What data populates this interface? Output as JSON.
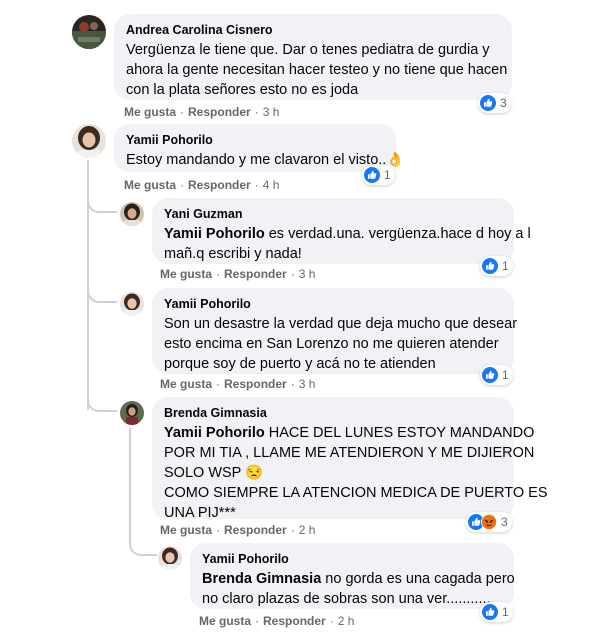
{
  "colors": {
    "bubble": "#f0f2f5",
    "secondary_text": "#65676b",
    "like_blue": "#1877f2",
    "thread_line": "#ced0d4"
  },
  "actions": {
    "like": "Me gusta",
    "reply": "Responder",
    "separator": "·"
  },
  "comments": [
    {
      "author": "Andrea Carolina Cisnero",
      "lines": [
        "Vergüenza le tiene que. Dar o tenes pediatra de gurdia y",
        "ahora la gente necesitan hacer testeo y no tiene que hacen",
        "con la plata señores esto no es joda"
      ],
      "time": "3 h",
      "reactions": {
        "icons": [
          "like-icon"
        ],
        "count": "3"
      }
    },
    {
      "author": "Yamii Pohorilo",
      "lines": [
        "Estoy mandando y me clavaron el visto.."
      ],
      "emoji": "👌",
      "time": "4 h",
      "reactions": {
        "icons": [
          "like-icon"
        ],
        "count": "1"
      }
    },
    {
      "author": "Yani Guzman",
      "mention": "Yamii Pohorilo",
      "lines": [
        " es verdad.una. vergüenza.hace d hoy a l",
        "mañ.q escribi y nada!"
      ],
      "time": "3 h",
      "reactions": {
        "icons": [
          "like-icon"
        ],
        "count": "1"
      }
    },
    {
      "author": "Yamii Pohorilo",
      "lines": [
        "Son un desastre la verdad que deja mucho que desear",
        "esto encima en San Lorenzo no me quieren atender",
        "porque soy de puerto y acá no te atienden"
      ],
      "time": "3 h",
      "reactions": {
        "icons": [
          "like-icon"
        ],
        "count": "1"
      }
    },
    {
      "author": "Brenda Gimnasia",
      "mention": "Yamii Pohorilo",
      "lines": [
        " HACE DEL LUNES ESTOY MANDANDO",
        "POR MI TIA , LLAME ME ATENDIERON Y ME DIJIERON",
        "SOLO WSP",
        "COMO SIEMPRE LA ATENCION MEDICA DE PUERTO ES",
        "UNA PIJ***"
      ],
      "emoji": "😒",
      "time": "2 h",
      "reactions": {
        "icons": [
          "like-icon",
          "angry-icon"
        ],
        "count": "3"
      }
    },
    {
      "author": "Yamii Pohorilo",
      "mention": "Brenda Gimnasia",
      "lines": [
        " no gorda es una cagada pero",
        "no claro plazas de sobras son una ver..........."
      ],
      "time": "2 h",
      "reactions": {
        "icons": [
          "like-icon"
        ],
        "count": "1"
      }
    }
  ]
}
